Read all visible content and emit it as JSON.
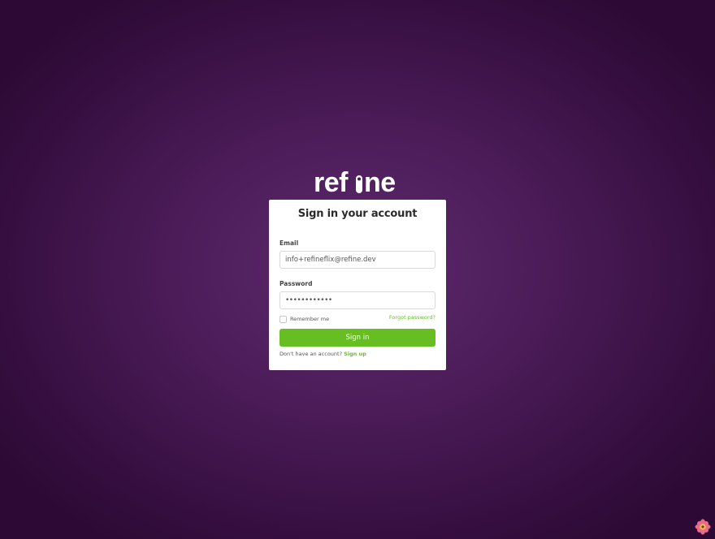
{
  "logo": {
    "text": "refine"
  },
  "login": {
    "title": "Sign in your account",
    "email_label": "Email",
    "email_value": "info+refineflix@refine.dev",
    "password_label": "Password",
    "password_value": "••••••••••••",
    "remember_label": "Remember me",
    "remember_checked": false,
    "forgot_link": "Forgot password?",
    "signin_button": "Sign in",
    "signup_prompt": "Don't have an account?",
    "signup_link": "Sign up"
  },
  "colors": {
    "accent": "#67be23",
    "background": "#4a1b57",
    "card": "#ffffff"
  },
  "icons": {
    "corner": "devtools-flower-icon"
  }
}
